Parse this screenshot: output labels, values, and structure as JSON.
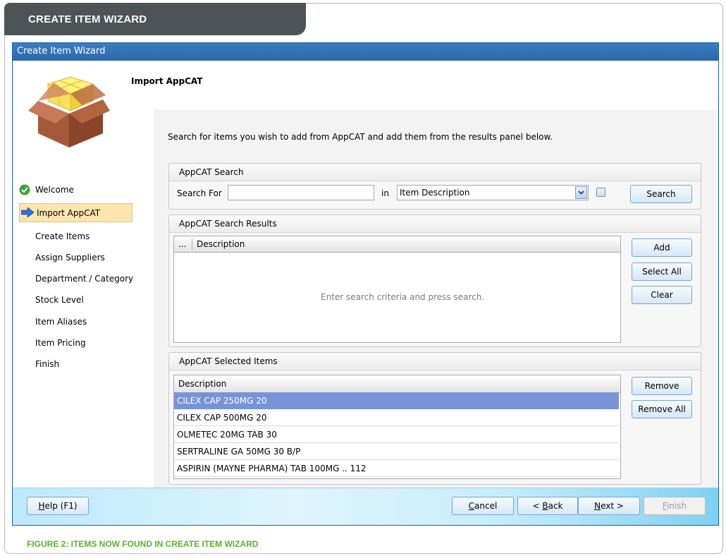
{
  "banner": {
    "title": "CREATE ITEM WIZARD"
  },
  "window": {
    "title": "Create Item Wizard"
  },
  "header": {
    "title": "Import AppCAT",
    "icon": "package-box-icon"
  },
  "steps": [
    {
      "label": "Welcome",
      "state": "completed"
    },
    {
      "label": "Import AppCAT",
      "state": "current"
    },
    {
      "label": "Create Items",
      "state": "pending"
    },
    {
      "label": "Assign Suppliers",
      "state": "pending"
    },
    {
      "label": "Department / Category",
      "state": "pending"
    },
    {
      "label": "Stock Level",
      "state": "pending"
    },
    {
      "label": "Item Aliases",
      "state": "pending"
    },
    {
      "label": "Item Pricing",
      "state": "pending"
    },
    {
      "label": "Finish",
      "state": "pending"
    }
  ],
  "instructions": "Search for items you wish to add from AppCAT and add them from the results panel below.",
  "search_panel": {
    "title": "AppCAT Search",
    "search_for_label": "Search For",
    "search_for_value": "",
    "in_label": "in",
    "field_selected": "Item Description",
    "checkbox_checked": false,
    "search_button": "Search"
  },
  "results_panel": {
    "title": "AppCAT Search Results",
    "col_ellipsis": "...",
    "col_description": "Description",
    "empty_message": "Enter search criteria and press search.",
    "add_button": "Add",
    "select_all_button": "Select All",
    "clear_button": "Clear"
  },
  "selected_panel": {
    "title": "AppCAT Selected Items",
    "col_description": "Description",
    "rows": [
      "CILEX CAP 250MG 20",
      "CILEX CAP 500MG 20",
      "OLMETEC 20MG TAB 30",
      "SERTRALINE GA 50MG 30 B/P",
      "ASPIRIN (MAYNE PHARMA) TAB 100MG .. 112"
    ],
    "selected_row": 0,
    "remove_button": "Remove",
    "remove_all_button": "Remove All"
  },
  "footer": {
    "help": {
      "pre": "",
      "ul": "H",
      "post": "elp (F1)"
    },
    "cancel": {
      "pre": "",
      "ul": "C",
      "post": "ancel"
    },
    "back": {
      "pre": "< ",
      "ul": "B",
      "post": "ack"
    },
    "next": {
      "pre": "",
      "ul": "N",
      "post": "ext >"
    },
    "finish": {
      "pre": "",
      "ul": "F",
      "post": "inish"
    }
  },
  "caption": "FIGURE 2: ITEMS NOW FOUND IN CREATE ITEM WIZARD",
  "colors": {
    "banner_bg": "#4d5458",
    "titlebar_bg": "#2a69ab",
    "selected_row": "#7894d7",
    "caption": "#5cb12e",
    "current_step_bg": "#fde6ae"
  }
}
